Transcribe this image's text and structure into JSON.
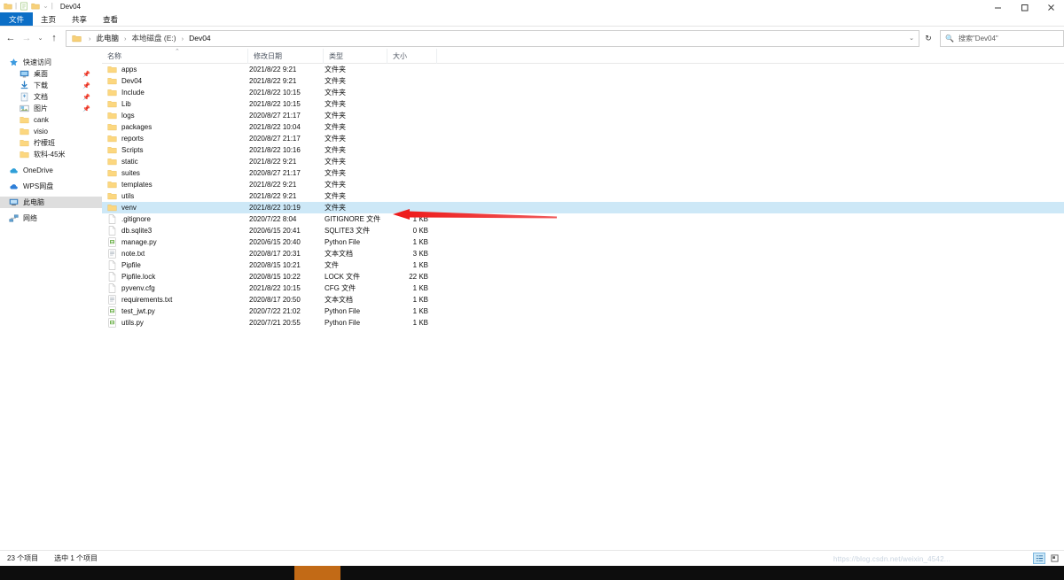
{
  "window": {
    "title": "Dev04",
    "quick_access_icons": [
      "folder-icon",
      "properties-icon",
      "new-folder-icon",
      "customize-caret-icon"
    ],
    "controls": {
      "minimize": "minimize-icon",
      "maximize": "maximize-icon",
      "close": "close-icon",
      "collapse_ribbon": "chevron-up-icon",
      "help": "?"
    }
  },
  "ribbon": {
    "tabs": [
      {
        "label": "文件",
        "active": true
      },
      {
        "label": "主页",
        "active": false
      },
      {
        "label": "共享",
        "active": false
      },
      {
        "label": "查看",
        "active": false
      }
    ]
  },
  "address": {
    "back": "←",
    "forward": "→",
    "recent": "⌄",
    "up": "↑",
    "breadcrumbs": [
      "此电脑",
      "本地磁盘 (E:)",
      "Dev04"
    ],
    "separator": "›",
    "dropdown_caret": "⌄",
    "refresh": "↻"
  },
  "search": {
    "placeholder": "搜索\"Dev04\"",
    "icon": "search-icon"
  },
  "sidebar": {
    "items": [
      {
        "label": "快速访问",
        "icon": "star-icon",
        "indent": false,
        "pin": false,
        "selected": false
      },
      {
        "label": "桌面",
        "icon": "desktop-icon",
        "indent": true,
        "pin": true,
        "selected": false
      },
      {
        "label": "下载",
        "icon": "download-icon",
        "indent": true,
        "pin": true,
        "selected": false
      },
      {
        "label": "文档",
        "icon": "documents-icon",
        "indent": true,
        "pin": true,
        "selected": false
      },
      {
        "label": "图片",
        "icon": "pictures-icon",
        "indent": true,
        "pin": true,
        "selected": false
      },
      {
        "label": "cank",
        "icon": "folder-icon",
        "indent": true,
        "pin": false,
        "selected": false
      },
      {
        "label": "visio",
        "icon": "folder-icon",
        "indent": true,
        "pin": false,
        "selected": false
      },
      {
        "label": "柠檬班",
        "icon": "folder-icon",
        "indent": true,
        "pin": false,
        "selected": false
      },
      {
        "label": "软科-45米",
        "icon": "folder-icon",
        "indent": true,
        "pin": false,
        "selected": false
      },
      {
        "label": "OneDrive",
        "icon": "onedrive-icon",
        "indent": false,
        "pin": false,
        "selected": false
      },
      {
        "label": "WPS网盘",
        "icon": "wps-cloud-icon",
        "indent": false,
        "pin": false,
        "selected": false
      },
      {
        "label": "此电脑",
        "icon": "this-pc-icon",
        "indent": false,
        "pin": false,
        "selected": true
      },
      {
        "label": "网络",
        "icon": "network-icon",
        "indent": false,
        "pin": false,
        "selected": false
      }
    ]
  },
  "filelist": {
    "columns": [
      "名称",
      "修改日期",
      "类型",
      "大小"
    ],
    "sort_indicator": "⌃",
    "rows": [
      {
        "name": "apps",
        "date": "2021/8/22 9:21",
        "type": "文件夹",
        "size": "",
        "icon": "folder-icon",
        "selected": false
      },
      {
        "name": "Dev04",
        "date": "2021/8/22 9:21",
        "type": "文件夹",
        "size": "",
        "icon": "folder-icon",
        "selected": false
      },
      {
        "name": "Include",
        "date": "2021/8/22 10:15",
        "type": "文件夹",
        "size": "",
        "icon": "folder-icon",
        "selected": false
      },
      {
        "name": "Lib",
        "date": "2021/8/22 10:15",
        "type": "文件夹",
        "size": "",
        "icon": "folder-icon",
        "selected": false
      },
      {
        "name": "logs",
        "date": "2020/8/27 21:17",
        "type": "文件夹",
        "size": "",
        "icon": "folder-icon",
        "selected": false
      },
      {
        "name": "packages",
        "date": "2021/8/22 10:04",
        "type": "文件夹",
        "size": "",
        "icon": "folder-icon",
        "selected": false
      },
      {
        "name": "reports",
        "date": "2020/8/27 21:17",
        "type": "文件夹",
        "size": "",
        "icon": "folder-icon",
        "selected": false
      },
      {
        "name": "Scripts",
        "date": "2021/8/22 10:16",
        "type": "文件夹",
        "size": "",
        "icon": "folder-icon",
        "selected": false
      },
      {
        "name": "static",
        "date": "2021/8/22 9:21",
        "type": "文件夹",
        "size": "",
        "icon": "folder-icon",
        "selected": false
      },
      {
        "name": "suites",
        "date": "2020/8/27 21:17",
        "type": "文件夹",
        "size": "",
        "icon": "folder-icon",
        "selected": false
      },
      {
        "name": "templates",
        "date": "2021/8/22 9:21",
        "type": "文件夹",
        "size": "",
        "icon": "folder-icon",
        "selected": false
      },
      {
        "name": "utils",
        "date": "2021/8/22 9:21",
        "type": "文件夹",
        "size": "",
        "icon": "folder-icon",
        "selected": false
      },
      {
        "name": "venv",
        "date": "2021/8/22 10:19",
        "type": "文件夹",
        "size": "",
        "icon": "folder-icon",
        "selected": true
      },
      {
        "name": ".gitignore",
        "date": "2020/7/22 8:04",
        "type": "GITIGNORE 文件",
        "size": "1 KB",
        "icon": "blank-file-icon",
        "selected": false
      },
      {
        "name": "db.sqlite3",
        "date": "2020/6/15 20:41",
        "type": "SQLITE3 文件",
        "size": "0 KB",
        "icon": "blank-file-icon",
        "selected": false
      },
      {
        "name": "manage.py",
        "date": "2020/6/15 20:40",
        "type": "Python File",
        "size": "1 KB",
        "icon": "python-file-icon",
        "selected": false
      },
      {
        "name": "note.txt",
        "date": "2020/8/17 20:31",
        "type": "文本文档",
        "size": "3 KB",
        "icon": "text-file-icon",
        "selected": false
      },
      {
        "name": "Pipfile",
        "date": "2020/8/15 10:21",
        "type": "文件",
        "size": "1 KB",
        "icon": "blank-file-icon",
        "selected": false
      },
      {
        "name": "Pipfile.lock",
        "date": "2020/8/15 10:22",
        "type": "LOCK 文件",
        "size": "22 KB",
        "icon": "blank-file-icon",
        "selected": false
      },
      {
        "name": "pyvenv.cfg",
        "date": "2021/8/22 10:15",
        "type": "CFG 文件",
        "size": "1 KB",
        "icon": "blank-file-icon",
        "selected": false
      },
      {
        "name": "requirements.txt",
        "date": "2020/8/17 20:50",
        "type": "文本文档",
        "size": "1 KB",
        "icon": "text-file-icon",
        "selected": false
      },
      {
        "name": "test_jwt.py",
        "date": "2020/7/22 21:02",
        "type": "Python File",
        "size": "1 KB",
        "icon": "python-file-icon",
        "selected": false
      },
      {
        "name": "utils.py",
        "date": "2020/7/21 20:55",
        "type": "Python File",
        "size": "1 KB",
        "icon": "python-file-icon",
        "selected": false
      }
    ]
  },
  "annotation": {
    "type": "arrow",
    "color": "#ee1c1c",
    "points_to": "venv"
  },
  "statusbar": {
    "item_count": "23 个项目",
    "selection": "选中 1 个项目",
    "watermark": "https://blog.csdn.net/weixin_4542...",
    "views": [
      {
        "name": "details-view",
        "active": true
      },
      {
        "name": "large-icons-view",
        "active": false
      }
    ]
  },
  "colors": {
    "accent": "#0b6ec6",
    "selection": "#cde8f7",
    "arrow": "#ee1c1c",
    "folder": "#fcd77f"
  }
}
